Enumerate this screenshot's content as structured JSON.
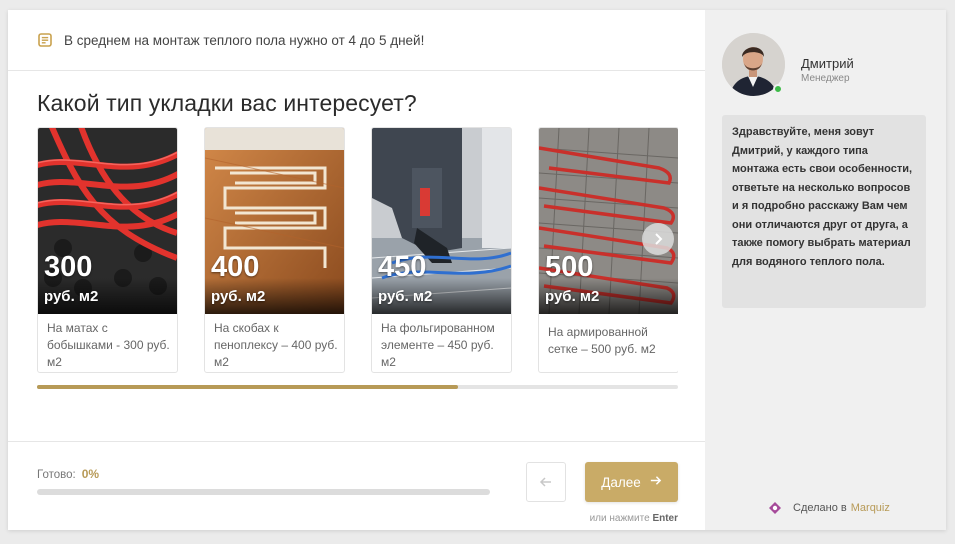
{
  "notice": {
    "text": "В среднем на монтаж теплого пола нужно от 4 до 5 дней!"
  },
  "question": "Какой тип укладки вас интересует?",
  "cards": [
    {
      "price": "300",
      "unit": "руб. м2",
      "label": "На матах с бобышками - 300 руб. м2"
    },
    {
      "price": "400",
      "unit": "руб. м2",
      "label": "На скобах к пеноплексу – 400 руб. м2"
    },
    {
      "price": "450",
      "unit": "руб. м2",
      "label": "На фольгированном элементе – 450 руб. м2"
    },
    {
      "price": "500",
      "unit": "руб. м2",
      "label": "На армированной сетке – 500 руб. м2"
    }
  ],
  "footer": {
    "ready_label": "Готово:",
    "ready_value": "0%",
    "progress": 0,
    "next_label": "Далее",
    "hint_prefix": "или нажмите",
    "hint_key": "Enter"
  },
  "manager": {
    "name": "Дмитрий",
    "role": "Менеджер",
    "message": "Здравствуйте, меня зовут Дмитрий, у каждого типа монтажа есть свои особенности, ответьте на несколько вопросов и я подробно расскажу Вам чем они отличаются друг от друга, а также помогу выбрать материал для водяного теплого пола."
  },
  "credit": {
    "prefix": "Сделано в",
    "brand": "Marquiz"
  },
  "colors": {
    "accent": "#c9ab67",
    "accent_dark": "#b79a57",
    "online": "#3dbb48"
  },
  "icons": {
    "notice": "list-note-icon",
    "next_arrow": "chevron-right-icon",
    "back": "arrow-left-icon",
    "forward": "arrow-right-icon",
    "brand": "marquiz-logo-icon"
  }
}
